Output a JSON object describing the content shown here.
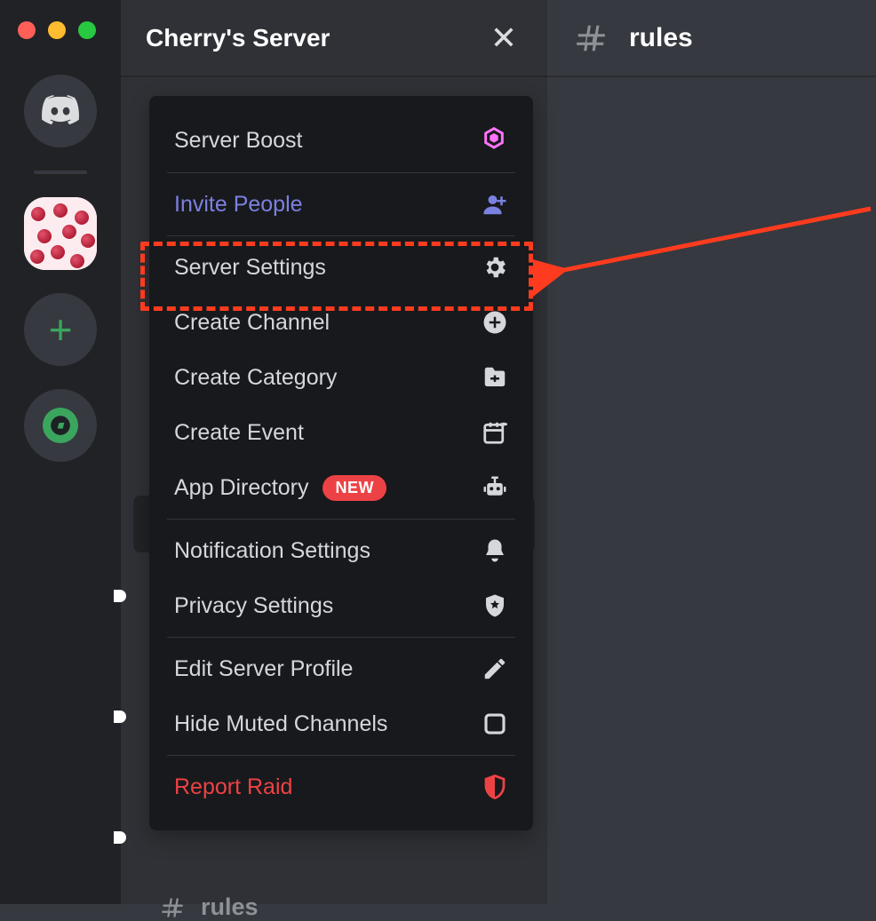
{
  "header": {
    "server_name": "Cherry's Server",
    "channel_name": "rules"
  },
  "menu": {
    "server_boost": "Server Boost",
    "invite_people": "Invite People",
    "server_settings": "Server Settings",
    "create_channel": "Create Channel",
    "create_category": "Create Category",
    "create_event": "Create Event",
    "app_directory": "App Directory",
    "app_directory_badge": "NEW",
    "notification_settings": "Notification Settings",
    "privacy_settings": "Privacy Settings",
    "edit_server_profile": "Edit Server Profile",
    "hide_muted_channels": "Hide Muted Channels",
    "report_raid": "Report Raid"
  },
  "sidebar_ghost_channel": "rules"
}
